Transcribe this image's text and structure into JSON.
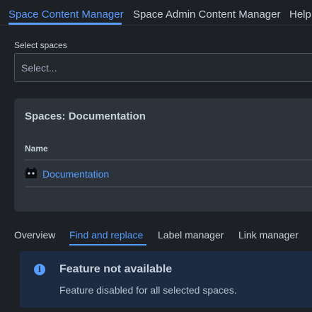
{
  "top_tabs": {
    "space_content_manager": "Space Content Manager",
    "space_admin_content_manager": "Space Admin Content Manager",
    "help": "Help"
  },
  "select_spaces": {
    "label": "Select spaces",
    "placeholder": "Select..."
  },
  "spaces_card": {
    "title": "Spaces: Documentation",
    "column_name": "Name",
    "rows": [
      {
        "name": "Documentation",
        "avatar_icon": "space-avatar-icon"
      }
    ]
  },
  "sub_tabs": {
    "overview": "Overview",
    "find_and_replace": "Find and replace",
    "label_manager": "Label manager",
    "link_manager": "Link manager",
    "active": "find_and_replace"
  },
  "info": {
    "icon": "info-icon",
    "title": "Feature not available",
    "message": "Feature disabled for all selected spaces."
  },
  "colors": {
    "accent": "#579dff",
    "background": "#1d2125",
    "card": "#2c333a",
    "info_background": "#1c2b41"
  }
}
